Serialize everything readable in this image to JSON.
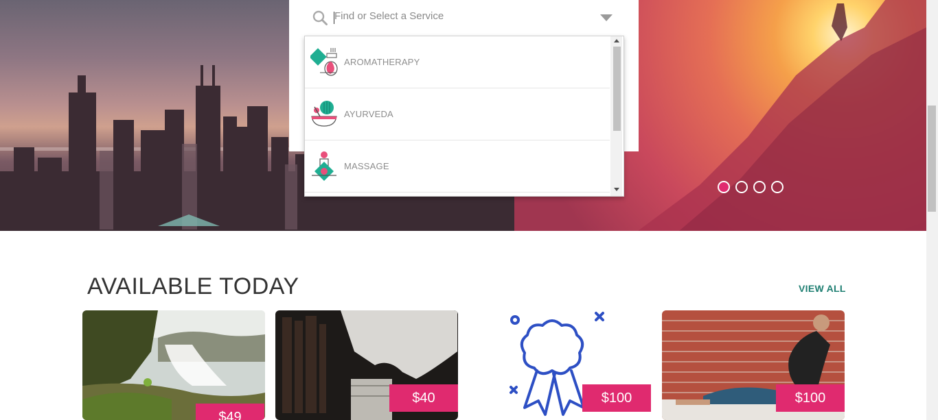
{
  "search": {
    "placeholder": "Find or Select a Service",
    "icon": "search-icon",
    "options": [
      {
        "label": "AROMATHERAPY",
        "icon": "aromatherapy-icon"
      },
      {
        "label": "AYURVEDA",
        "icon": "ayurveda-icon"
      },
      {
        "label": "MASSAGE",
        "icon": "massage-icon"
      }
    ]
  },
  "carousel": {
    "slide_count": 4,
    "active_index": 0
  },
  "section": {
    "title": "AVAILABLE TODAY",
    "view_all": "VIEW ALL"
  },
  "cards": [
    {
      "price": "$49",
      "image": "waterfall-image"
    },
    {
      "price": "$40",
      "image": "books-statue-image"
    },
    {
      "price": "$100",
      "image": "award-ribbon-icon"
    },
    {
      "price": "$100",
      "image": "yoga-man-image"
    }
  ],
  "colors": {
    "accent": "#e02a6f",
    "teal": "#1f7f72",
    "icon_teal": "#1fae92",
    "ribbon_blue": "#2d4fc4"
  }
}
